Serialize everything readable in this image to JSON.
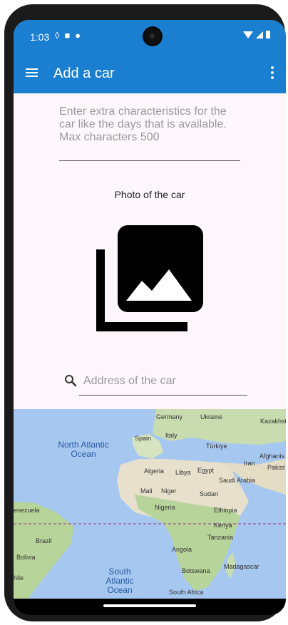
{
  "status": {
    "time": "1:03",
    "left_icons": [
      "shield-icon",
      "sd-card-icon",
      "circle-icon"
    ],
    "right_icons": [
      "wifi-icon",
      "signal-icon",
      "battery-icon"
    ]
  },
  "appbar": {
    "title": "Add a car",
    "background": "#1a7fd1"
  },
  "form": {
    "extra_characteristics": "Enter extra characteristics for the car like the days that is available. Max characters 500",
    "photo_label": "Photo of the car",
    "address_placeholder": "Address of the car"
  },
  "map": {
    "countries": [
      "Germany",
      "Ukraine",
      "Kazakhst",
      "Spain",
      "Italy",
      "Türkiye",
      "Iran",
      "Afghanis",
      "Pakist",
      "Algeria",
      "Libya",
      "Egypt",
      "Saudi Arabia",
      "Mali",
      "Niger",
      "Sudan",
      "Nigeria",
      "Ethiopia",
      "enezuela",
      "Kenya",
      "Tanzania",
      "Brazil",
      "Angola",
      "Bolivia",
      "Madagascar",
      "Botswana",
      "hile",
      "South Africa"
    ],
    "oceans": [
      "North Atlantic Ocean",
      "South Atlantic Ocean"
    ]
  }
}
